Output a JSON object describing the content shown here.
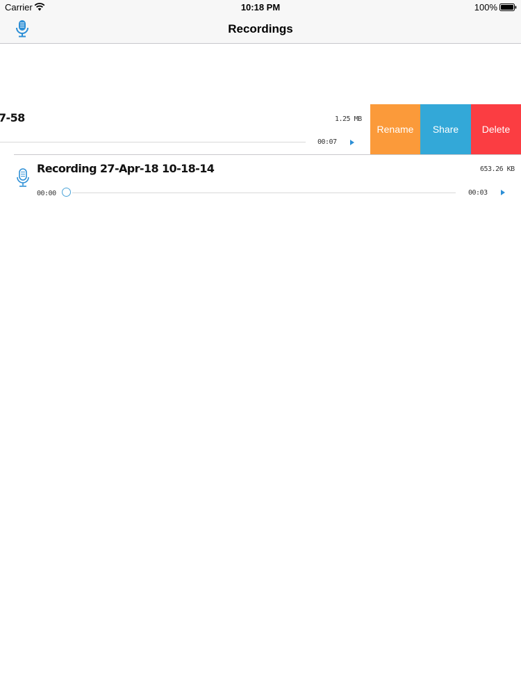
{
  "status_bar": {
    "carrier": "Carrier",
    "time": "10:18 PM",
    "battery": "100%"
  },
  "nav": {
    "title": "Recordings",
    "left_icon": "microphone-icon"
  },
  "recordings": [
    {
      "title": "7-58",
      "size": "1.25 MB",
      "duration": "00:07",
      "swiped": true
    },
    {
      "title": "Recording 27-Apr-18 10-18-14",
      "size": "653.26 KB",
      "current_time": "00:00",
      "duration": "00:03",
      "swiped": false
    }
  ],
  "actions": {
    "rename": "Rename",
    "share": "Share",
    "delete": "Delete"
  },
  "colors": {
    "accent": "#2d8fd6",
    "rename": "#fb9a3a",
    "share": "#33a8d8",
    "delete": "#fb3d42"
  }
}
